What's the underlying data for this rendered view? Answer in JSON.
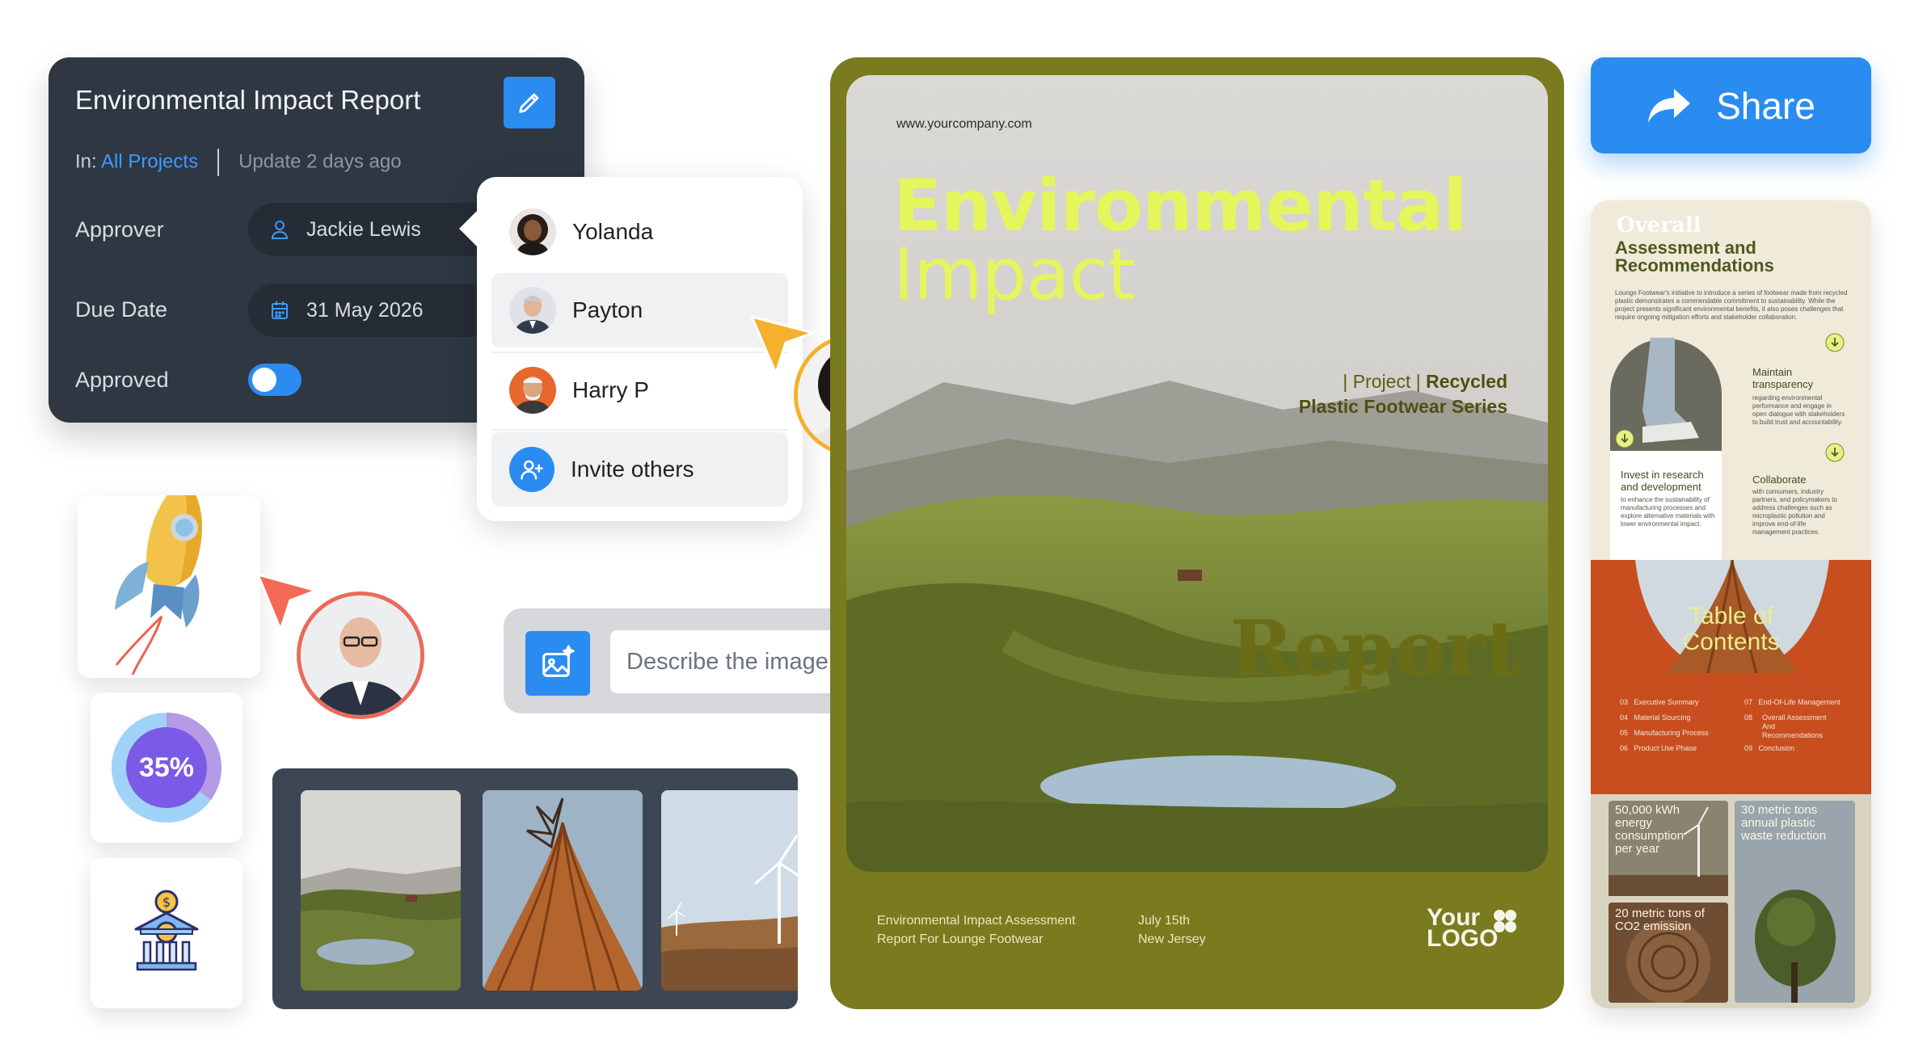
{
  "panel": {
    "title": "Environmental Impact Report",
    "in_label": "In:",
    "project_link": "All Projects",
    "updated": "Update 2 days ago",
    "approver_label": "Approver",
    "approver_value": "Jackie Lewis",
    "due_label": "Due Date",
    "due_value": "31 May 2026",
    "approved_label": "Approved",
    "approved": true
  },
  "dropdown": {
    "people": [
      "Yolanda",
      "Payton",
      "Harry P"
    ],
    "invite_label": "Invite others"
  },
  "stat": {
    "percent_label": "35%",
    "percent_value": 35
  },
  "prompt": {
    "placeholder": "Describe the image to generate"
  },
  "cover": {
    "url": "www.yourcompany.com",
    "title_line1": "Environmental",
    "title_line2": "Impact",
    "subtitle_prefix": "| Project | ",
    "subtitle_bold1": "Recycled",
    "subtitle_line2": "Plastic Footwear Series",
    "report_word": "Report",
    "footer_left_1": "Environmental Impact Assessment",
    "footer_left_2": "Report For Lounge Footwear",
    "footer_mid_1": "July 15th",
    "footer_mid_2": "New Jersey",
    "logo_line1": "Your",
    "logo_line2": "LOGO",
    "colors": {
      "frame": "#7a7a1e",
      "title": "#e5f55c"
    }
  },
  "share": {
    "label": "Share"
  },
  "side": {
    "overall_word": "Overall",
    "heading1": "Assessment and",
    "heading2": "Recommendations",
    "intro": "Lounge Footwear's initiative to introduce a series of footwear made from recycled plastic demonstrates a commendable commitment to sustainability. While the project presents significant environmental benefits, it also poses challenges that require ongoing mitigation efforts and stakeholder collaboration.",
    "rec1_title": "Maintain transparency",
    "rec1_text": "regarding environmental performance and engage in open dialogue with stakeholders to build trust and accountability.",
    "rec2_title": "Invest in research and development",
    "rec2_text": "to enhance the sustainability of manufacturing processes and explore alternative materials with lower environmental impact.",
    "rec3_title": "Collaborate",
    "rec3_text": "with consumers, industry partners, and policymakers to address challenges such as microplastic pollution and improve end-of-life management practices.",
    "toc_title1": "Table of",
    "toc_title2": "Contents",
    "toc_left": [
      {
        "num": "03",
        "label": "Executive Summary"
      },
      {
        "num": "04",
        "label": "Material Sourcing"
      },
      {
        "num": "05",
        "label": "Manufacturing Process"
      },
      {
        "num": "06",
        "label": "Product Use Phase"
      }
    ],
    "toc_right": [
      {
        "num": "07",
        "label": "End-Of-Life Management"
      },
      {
        "num": "08",
        "label": "Overall Assessment And Recommendations"
      },
      {
        "num": "09",
        "label": "Conclusion"
      }
    ],
    "stat1": "50,000 kWh energy consumption per year",
    "stat2": "30 metric tons annual plastic waste reduction",
    "stat3": "20 metric tons of CO2 emission"
  }
}
